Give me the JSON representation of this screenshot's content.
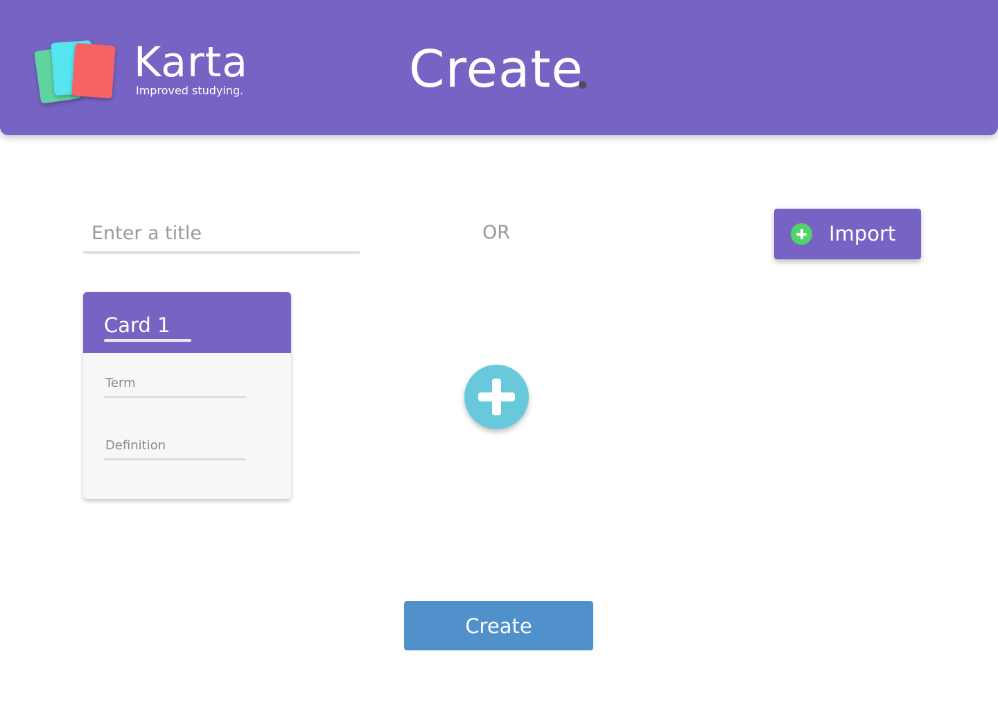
{
  "header": {
    "brand_name": "Karta",
    "tagline": "Improved studying.",
    "page_title": "Create",
    "logo_icon": "stacked-cards-logo"
  },
  "form": {
    "title_placeholder": "Enter a title",
    "or_text": "OR",
    "import_label": "Import",
    "import_icon": "plus-circle-icon",
    "add_card_icon": "plus-icon",
    "create_label": "Create"
  },
  "cards": [
    {
      "title": "Card 1",
      "term_placeholder": "Term",
      "definition_placeholder": "Definition"
    }
  ],
  "colors": {
    "header_bg": "#7663c4",
    "import_icon": "#4fd36a",
    "add_button": "#68c8dc",
    "create_button": "#5091cc",
    "logo_cards": [
      "#5fd3a0",
      "#56e4ee",
      "#f76364"
    ]
  }
}
